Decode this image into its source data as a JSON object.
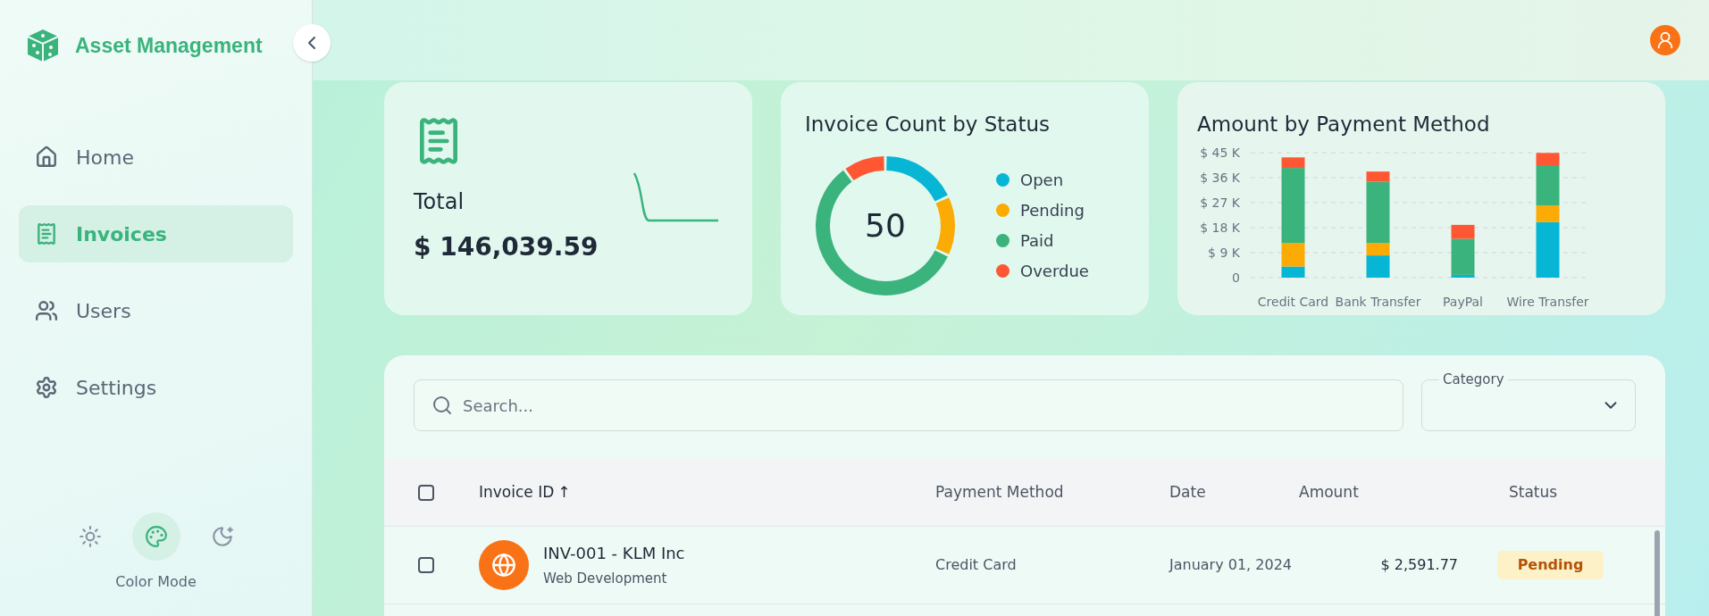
{
  "sidebar": {
    "brand": "Asset Management",
    "items": [
      {
        "label": "Home",
        "selected": false
      },
      {
        "label": "Invoices",
        "selected": true
      },
      {
        "label": "Users",
        "selected": false
      },
      {
        "label": "Settings",
        "selected": false
      }
    ],
    "color_modes": [
      {
        "selected": false
      },
      {
        "selected": true
      },
      {
        "selected": false
      }
    ],
    "color_mode_label": "Color Mode"
  },
  "total_card": {
    "label": "Total",
    "value": "$ 146,039.59"
  },
  "status_card": {
    "title": "Invoice Count by Status",
    "center": "50",
    "legend": [
      {
        "label": "Open",
        "color": "#06b6d4"
      },
      {
        "label": "Pending",
        "color": "#fbab03"
      },
      {
        "label": "Paid",
        "color": "#3ab37c"
      },
      {
        "label": "Overdue",
        "color": "#ff5733"
      }
    ]
  },
  "payment_card": {
    "title": "Amount by Payment Method",
    "chart_data": {
      "type": "bar",
      "stacked": true,
      "grid": true,
      "categories": [
        "Credit Card",
        "Bank Transfer",
        "PayPal",
        "Wire Transfer"
      ],
      "ylim": [
        0,
        45
      ],
      "yticks": [
        {
          "value": 0,
          "label": "0"
        },
        {
          "value": 9,
          "label": "$ 9 K"
        },
        {
          "value": 18,
          "label": "$ 18 K"
        },
        {
          "value": 27,
          "label": "$ 27 K"
        },
        {
          "value": 36,
          "label": "$ 36 K"
        },
        {
          "value": 45,
          "label": "$ 45 K"
        }
      ],
      "series": [
        {
          "color": "#06b6d4",
          "values": [
            4,
            8,
            1,
            20
          ]
        },
        {
          "color": "#fbab03",
          "values": [
            8.5,
            4.5,
            0,
            6
          ]
        },
        {
          "color": "#3ab37c",
          "values": [
            27,
            22,
            13,
            14.5
          ]
        },
        {
          "color": "#ff5733",
          "values": [
            3.8,
            3.7,
            5,
            4.4
          ]
        }
      ]
    }
  },
  "table": {
    "search": {
      "placeholder": "Search..."
    },
    "category": {
      "label": "Category"
    },
    "columns": [
      "Invoice ID",
      "Payment Method",
      "Date",
      "Amount",
      "Status"
    ],
    "sort_indicator": "↑",
    "header_checked": false,
    "rows": [
      {
        "checked": false,
        "id": "INV-001 - KLM Inc",
        "category": "Web Development",
        "payment": "Credit Card",
        "date": "January 01, 2024",
        "amount": "$ 2,591.77",
        "status": "Pending"
      }
    ]
  }
}
